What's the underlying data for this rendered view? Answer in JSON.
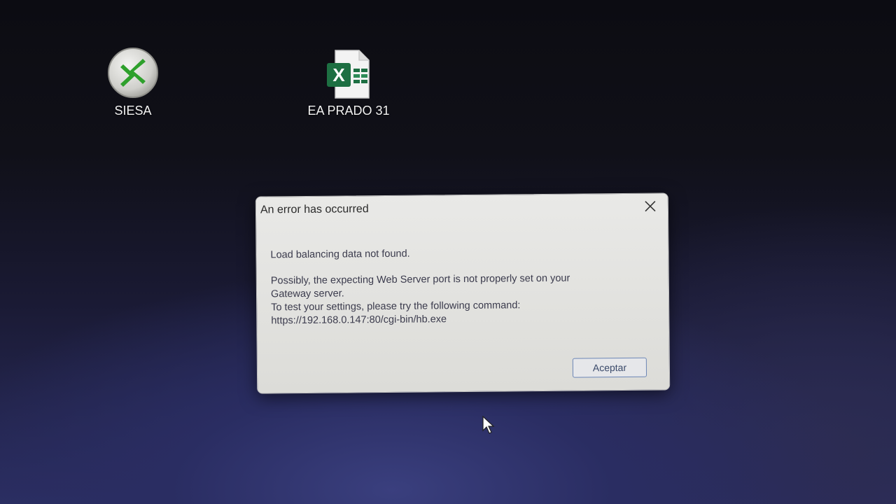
{
  "desktop": {
    "icons": [
      {
        "label": "SIESA",
        "icon": "remote-desktop-icon"
      },
      {
        "label": "EA PRADO 31",
        "icon": "excel-file-icon"
      }
    ]
  },
  "dialog": {
    "title": "An error has occurred",
    "close_icon": "close-icon",
    "message": {
      "line1": "Load balancing data not found.",
      "line2": "Possibly, the expecting Web Server port is not properly set on your",
      "line3": "Gateway server.",
      "line4": "To test your settings, please try the following command:",
      "line5": "https://192.168.0.147:80/cgi-bin/hb.exe"
    },
    "ok_button": "Aceptar"
  },
  "colors": {
    "dialog_bg": "#e4e4e2",
    "button_border": "#6c86b6",
    "excel_green": "#1d6f42",
    "siesa_green": "#2ea02c"
  }
}
